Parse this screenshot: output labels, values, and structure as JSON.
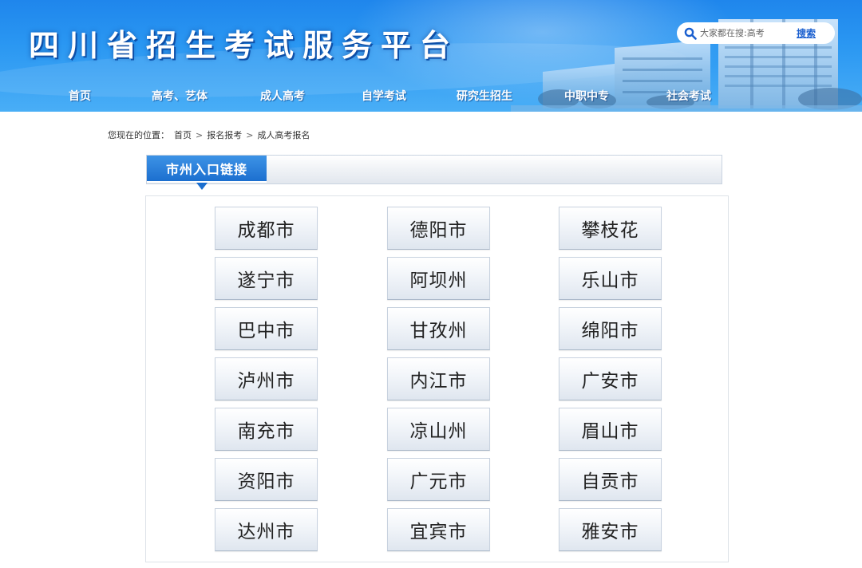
{
  "header": {
    "site_title": "四川省招生考试服务平台",
    "search": {
      "placeholder": "大家都在搜:高考",
      "button_label": "搜索"
    }
  },
  "nav": {
    "items": [
      {
        "label": "首页"
      },
      {
        "label": "高考、艺体"
      },
      {
        "label": "成人高考"
      },
      {
        "label": "自学考试"
      },
      {
        "label": "研究生招生"
      },
      {
        "label": "中职中专"
      },
      {
        "label": "社会考试"
      }
    ]
  },
  "breadcrumb": {
    "prefix": "您现在的位置：",
    "items": [
      "首页",
      "报名报考",
      "成人高考报名"
    ],
    "separator": ">"
  },
  "section": {
    "title": "市州入口链接"
  },
  "cities": [
    [
      "成都市",
      "德阳市",
      "攀枝花"
    ],
    [
      "遂宁市",
      "阿坝州",
      "乐山市"
    ],
    [
      "巴中市",
      "甘孜州",
      "绵阳市"
    ],
    [
      "泸州市",
      "内江市",
      "广安市"
    ],
    [
      "南充市",
      "凉山州",
      "眉山市"
    ],
    [
      "资阳市",
      "广元市",
      "自贡市"
    ],
    [
      "达州市",
      "宜宾市",
      "雅安市"
    ]
  ],
  "colors": {
    "banner_blue": "#2a97f2",
    "tab_blue": "#1c6fcf",
    "link_blue": "#1a5fcf"
  }
}
